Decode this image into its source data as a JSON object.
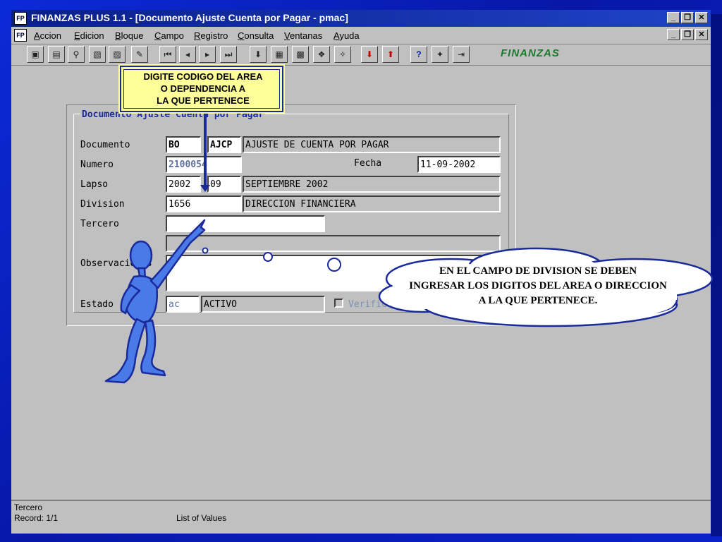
{
  "app": {
    "title": "FINANZAS PLUS 1.1 - [Documento Ajuste Cuenta por Pagar - pmac]",
    "menu": [
      "Accion",
      "Edicion",
      "Bloque",
      "Campo",
      "Registro",
      "Consulta",
      "Ventanas",
      "Ayuda"
    ],
    "toolbar_icons": [
      "save-icon",
      "add-record-icon",
      "find-icon",
      "delete-icon",
      "clear-icon",
      "edit-icon",
      "first-record-icon",
      "prev-record-icon",
      "next-record-icon",
      "last-record-icon",
      "download-icon",
      "list-icon",
      "form-icon",
      "query-icon",
      "run-icon",
      "red-down-icon",
      "red-up-icon",
      "help-icon",
      "tools-icon",
      "exit-icon"
    ],
    "logo": "FINANZAS"
  },
  "form": {
    "legend": "Documento Ajuste Cuenta por Pagar",
    "labels": {
      "documento": "Documento",
      "numero": "Numero",
      "fecha": "Fecha",
      "lapso": "Lapso",
      "division": "Division",
      "tercero": "Tercero",
      "observaciones": "Observaciones",
      "estado": "Estado",
      "verificado": "Verificado"
    },
    "values": {
      "doc_code": "BO",
      "doc_type": "AJCP",
      "doc_desc": "AJUSTE DE CUENTA POR PAGAR",
      "numero": "2100054",
      "fecha": "11-09-2002",
      "lapso_year": "2002",
      "lapso_month": "09",
      "lapso_desc": "SEPTIEMBRE 2002",
      "division_code": "1656",
      "division_desc": "DIRECCION FINANCIERA",
      "tercero": "",
      "tercero_desc": "",
      "observaciones": "",
      "estado_code": "ac",
      "estado_desc": "ACTIVO"
    }
  },
  "status": {
    "field": "Tercero",
    "record": "Record: 1/1",
    "hint": "List of Values"
  },
  "annotations": {
    "note_lines": [
      "DIGITE CODIGO DEL AREA",
      "O DEPENDENCIA A",
      "LA QUE PERTENECE"
    ],
    "cloud_lines": [
      "EN EL CAMPO DE DIVISION SE DEBEN",
      "INGRESAR LOS DIGITOS DEL AREA O DIRECCION",
      "A LA QUE PERTENECE."
    ]
  },
  "colors": {
    "accent": "#1a2a9a",
    "note_bg": "#ffff99",
    "figure": "#4a7ae8"
  }
}
